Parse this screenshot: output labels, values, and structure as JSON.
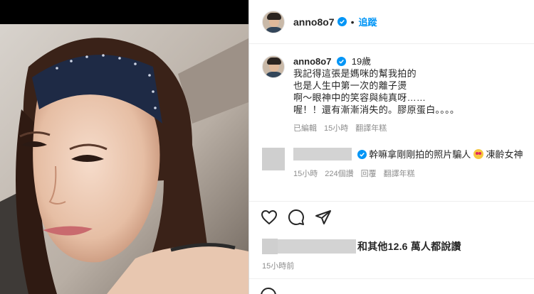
{
  "header": {
    "username": "anno8o7",
    "separator": "•",
    "follow_label": "追蹤"
  },
  "caption": {
    "username": "anno8o7",
    "age": "19歲",
    "lines": [
      "我記得這張是媽咪的幫我拍的",
      "也是人生中第一次的離子燙",
      "啊～眼神中的笑容與純真呀……",
      "喔！！還有漸漸消失的。膠原蛋白。。。。"
    ],
    "edited": "已編輯",
    "time": "15小時",
    "translate": "翻譯年糕"
  },
  "comment": {
    "text_a": "幹嘛拿剛剛拍的照片騙人",
    "text_b": "凍齡女神",
    "time": "15小時",
    "likes": "224個讚",
    "reply": "回覆",
    "translate": "翻譯年糕"
  },
  "likes": {
    "text": "和其他12.6 萬人都說讚"
  },
  "time_ago": "15小時前",
  "colors": {
    "accent": "#0095f6",
    "text": "#262626",
    "muted": "#8e8e8e",
    "verified": "#0095f6"
  },
  "icons": {
    "like": "heart-icon",
    "comment": "comment-icon",
    "share": "share-icon",
    "verified": "verified-badge-icon"
  }
}
